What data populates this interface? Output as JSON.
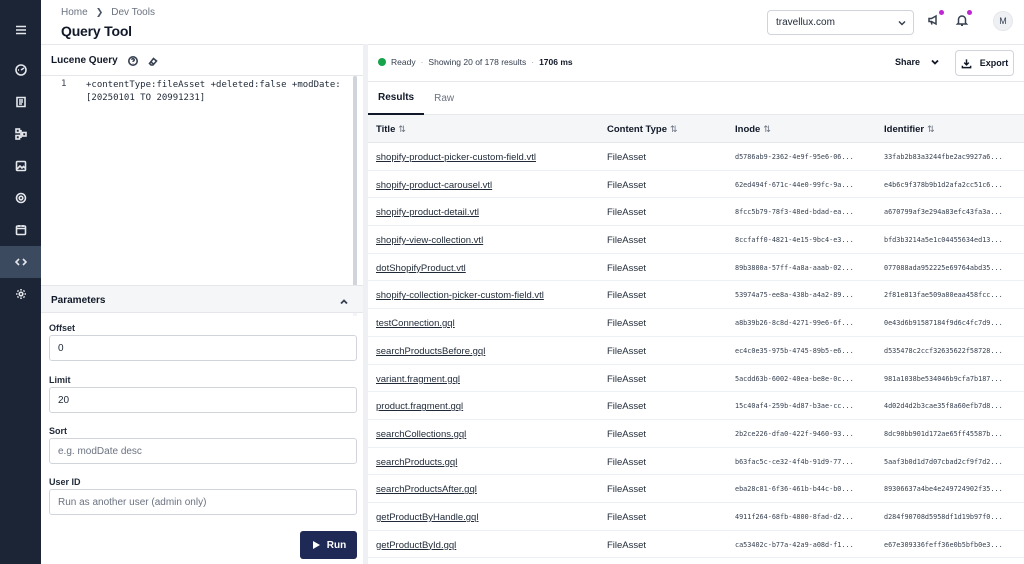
{
  "rail": {
    "items": [
      {
        "icon": "menu-icon"
      },
      {
        "icon": "dashboard-icon"
      },
      {
        "icon": "content-icon"
      },
      {
        "icon": "schema-icon"
      },
      {
        "icon": "media-icon"
      },
      {
        "icon": "target-icon"
      },
      {
        "icon": "calendar-icon"
      },
      {
        "icon": "dev-tools-icon",
        "active": true
      },
      {
        "icon": "settings-icon"
      }
    ]
  },
  "header": {
    "breadcrumb": [
      "Home",
      "Dev Tools"
    ],
    "title": "Query Tool",
    "site": "travellux.com"
  },
  "query": {
    "label": "Lucene Query",
    "line_number": "1",
    "code": "+contentType:fileAsset +deleted:false +modDate:[20250101 TO 20991231]"
  },
  "params": {
    "label": "Parameters",
    "offset_label": "Offset",
    "offset_value": "0",
    "limit_label": "Limit",
    "limit_value": "20",
    "sort_label": "Sort",
    "sort_placeholder": "e.g. modDate desc",
    "user_label": "User ID",
    "user_placeholder": "Run as another user (admin only)",
    "run_label": "Run"
  },
  "results": {
    "status": "Ready",
    "showing": "Showing 20 of 178 results",
    "time": "1706 ms",
    "share_label": "Share",
    "export_label": "Export",
    "tabs": [
      "Results",
      "Raw"
    ],
    "columns": [
      "Title",
      "Content Type",
      "Inode",
      "Identifier"
    ],
    "rows": [
      {
        "title": "shopify-product-picker-custom-field.vtl",
        "type": "FileAsset",
        "inode": "d5786ab9-2362-4e9f-95e6-06...",
        "ident": "33fab2b83a3244fbe2ac9927a6..."
      },
      {
        "title": "shopify-product-carousel.vtl",
        "type": "FileAsset",
        "inode": "62ed494f-671c-44e0-99fc-9a...",
        "ident": "e4b6c9f378b9b1d2afa2cc51c6..."
      },
      {
        "title": "shopify-product-detail.vtl",
        "type": "FileAsset",
        "inode": "8fcc5b79-78f3-48ed-bdad-ea...",
        "ident": "a670799af3e294a83efc43fa3a..."
      },
      {
        "title": "shopify-view-collection.vtl",
        "type": "FileAsset",
        "inode": "8ccfaff0-4821-4e15-9bc4-e3...",
        "ident": "bfd3b3214a5e1c04455634ed13..."
      },
      {
        "title": "dotShopifyProduct.vtl",
        "type": "FileAsset",
        "inode": "89b3800a-57ff-4a8a-aaab-02...",
        "ident": "077088ada952225e69764abd35..."
      },
      {
        "title": "shopify-collection-picker-custom-field.vtl",
        "type": "FileAsset",
        "inode": "53974a75-ee8a-438b-a4a2-89...",
        "ident": "2f81e813fae509a80eaa458fcc..."
      },
      {
        "title": "testConnection.gql",
        "type": "FileAsset",
        "inode": "a8b39b26-8c8d-4271-99e6-6f...",
        "ident": "0e43d6b91587184f9d6c4fc7d9..."
      },
      {
        "title": "searchProductsBefore.gql",
        "type": "FileAsset",
        "inode": "ec4c0e35-975b-4745-89b5-e6...",
        "ident": "d535478c2ccf32635622f58728..."
      },
      {
        "title": "variant.fragment.gql",
        "type": "FileAsset",
        "inode": "5acdd63b-6002-40ea-be8e-0c...",
        "ident": "981a1038be534046b9cfa7b187..."
      },
      {
        "title": "product.fragment.gql",
        "type": "FileAsset",
        "inode": "15c40af4-259b-4d87-b3ae-cc...",
        "ident": "4d02d4d2b3cae35f8a60efb7d8..."
      },
      {
        "title": "searchCollections.gql",
        "type": "FileAsset",
        "inode": "2b2ce226-dfa0-422f-9460-93...",
        "ident": "8dc90bb901d172ae65ff45587b..."
      },
      {
        "title": "searchProducts.gql",
        "type": "FileAsset",
        "inode": "b63fac5c-ce32-4f4b-91d9-77...",
        "ident": "5aaf3b0d1d7d07cbad2cf9f7d2..."
      },
      {
        "title": "searchProductsAfter.gql",
        "type": "FileAsset",
        "inode": "eba28c81-6f36-461b-b44c-b0...",
        "ident": "89306637a4be4e249724902f35..."
      },
      {
        "title": "getProductByHandle.gql",
        "type": "FileAsset",
        "inode": "4911f264-68fb-4800-8fad-d2...",
        "ident": "d284f90708d5958df1d19b97f0..."
      },
      {
        "title": "getProductById.gql",
        "type": "FileAsset",
        "inode": "ca53402c-b77a-42a9-a08d-f1...",
        "ident": "e67e309336feff36e0b5bfb0e3..."
      }
    ]
  },
  "colors": {
    "rail_bg": "#1b2536",
    "rail_active": "#3c4a60",
    "run_button": "#1e2a55",
    "status_ready": "#16a34a",
    "notification_dot": "#c026d3"
  }
}
